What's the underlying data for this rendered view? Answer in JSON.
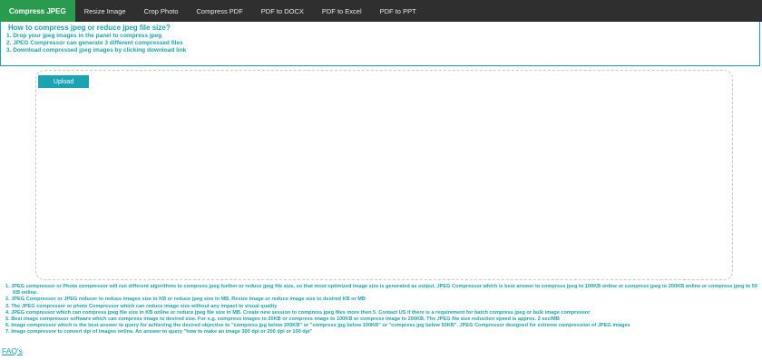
{
  "nav": {
    "items": [
      {
        "label": "Compress JPEG"
      },
      {
        "label": "Resize Image"
      },
      {
        "label": "Crop Photo"
      },
      {
        "label": "Compress PDF"
      },
      {
        "label": "PDF to DOCX"
      },
      {
        "label": "PDF to Excel"
      },
      {
        "label": "PDF to PPT"
      }
    ]
  },
  "howto": {
    "title": "How to compress jpeg or reduce jpeg file size?",
    "steps": [
      "1.  Drop your jpeg images in the panel to compress jpeg",
      "2.  JPEG Compressor can generate 3 different compressed files",
      "3.  Download compressed jpeg images by clicking download link"
    ]
  },
  "upload": {
    "label": "Upload"
  },
  "features": [
    "1.  JPEG compressor or Photo compressor will run different algorithms to compress jpeg further or reduce jpeg file size, so that most optimized image size is generated as output. JPEG Compressor which is best answer to compress jpeg to 100KB online or compress jpeg to 200KB online or compress jpeg to 50 KB online.",
    "2.  JPEG Compressor or JPEG reducer to reduce images size in KB or reduce jpeg size in MB. Resize image or reduce image size to desired KB or MB",
    "3.  The JPEG compressor or photo Compressor which can reduce image size without any impact to visual quality",
    "4.  JPEG compressor which can compress jpeg file size in KB online or reduce jpeg file size in MB. Create new session to compress jpeg files more then 5. Contact US if there is a requirement for batch compress jpeg or bulk image compressor",
    "5.  Best image compressor software which can compress image to desired size. For e.g. compress images to 20KB or compress image to 100KB or compress image to 200KB. The JPEG file size reduction speed is approx. 2 sec/MB",
    "6.  Image compressor which is the best answer to query for achieving the desired objective to \"compress jpg below 200KB\" or \"compress jpg below 100KB\" or \"compress jpg below 50KB\". JPEG Compressor designed for extreme compression of JPEG images",
    "7.  Image compressor to convert dpi of images online. An answer to query \"how to make an image 300 dpi or 200 dpi or 100 dpi\""
  ],
  "faqs": {
    "label": "FAQ's"
  },
  "colors": {
    "accent": "#19a3a8",
    "nav_bg": "#2f2f2f",
    "active_tab": "#2a9a4f",
    "upload_btn": "#19a3b3"
  }
}
